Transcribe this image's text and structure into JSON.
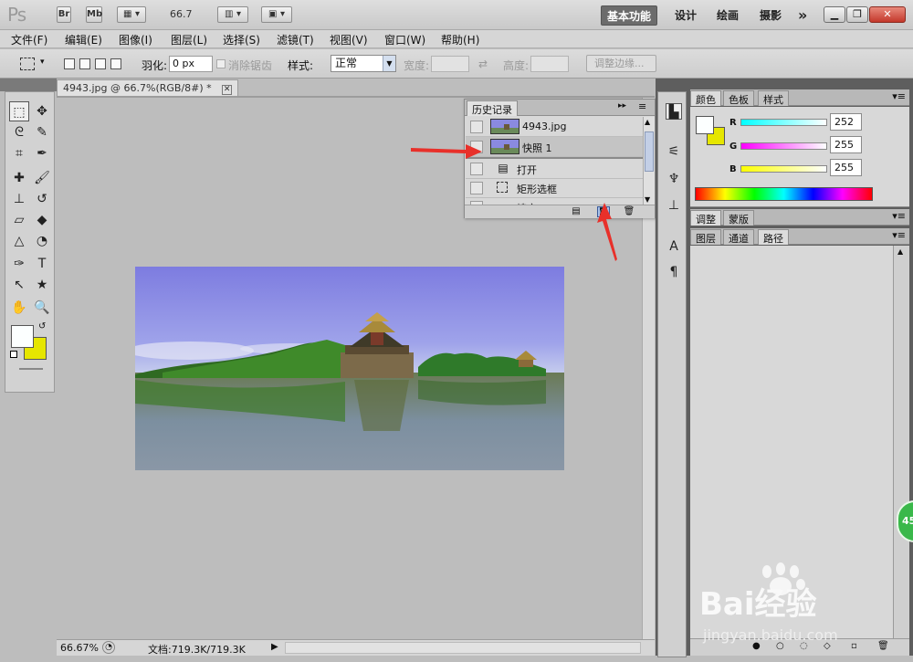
{
  "appbar": {
    "logo": "Ps",
    "bridge": "Br",
    "minibridge": "Mb",
    "zoom": "66.7",
    "workspaces": [
      "基本功能",
      "设计",
      "绘画",
      "摄影"
    ],
    "more": "»"
  },
  "menus": [
    "文件(F)",
    "编辑(E)",
    "图像(I)",
    "图层(L)",
    "选择(S)",
    "滤镜(T)",
    "视图(V)",
    "窗口(W)",
    "帮助(H)"
  ],
  "options": {
    "feather_label": "羽化:",
    "feather_value": "0 px",
    "antialias_label": "消除锯齿",
    "style_label": "样式:",
    "style_value": "正常",
    "width_label": "宽度:",
    "height_label": "高度:",
    "refine_button": "调整边缘..."
  },
  "document": {
    "tab_title": "4943.jpg @ 66.7%(RGB/8#) *",
    "zoom_status": "66.67%",
    "doc_status": "文档:719.3K/719.3K"
  },
  "history": {
    "tab": "历史记录",
    "rows": [
      {
        "label": "4943.jpg",
        "type": "snapshot"
      },
      {
        "label": "快照 1",
        "type": "snapshot"
      },
      {
        "label": "打开",
        "type": "step",
        "icon": "open-icon"
      },
      {
        "label": "矩形选框",
        "type": "step",
        "icon": "marquee-icon"
      },
      {
        "label": "填充",
        "type": "step",
        "icon": "fill-icon"
      }
    ]
  },
  "color_panel": {
    "tabs": [
      "颜色",
      "色板",
      "样式"
    ],
    "r_label": "R",
    "g_label": "G",
    "b_label": "B",
    "r": "252",
    "g": "255",
    "b": "255",
    "foreground": "#fcffff",
    "background": "#e6e600"
  },
  "adjust_panel": {
    "tabs": [
      "调整",
      "蒙版"
    ]
  },
  "layers_panel": {
    "tabs": [
      "图层",
      "通道",
      "路径"
    ]
  },
  "watermark": {
    "brand": "Bai经验",
    "url": "jingyan.baidu.com"
  },
  "badge": "45"
}
